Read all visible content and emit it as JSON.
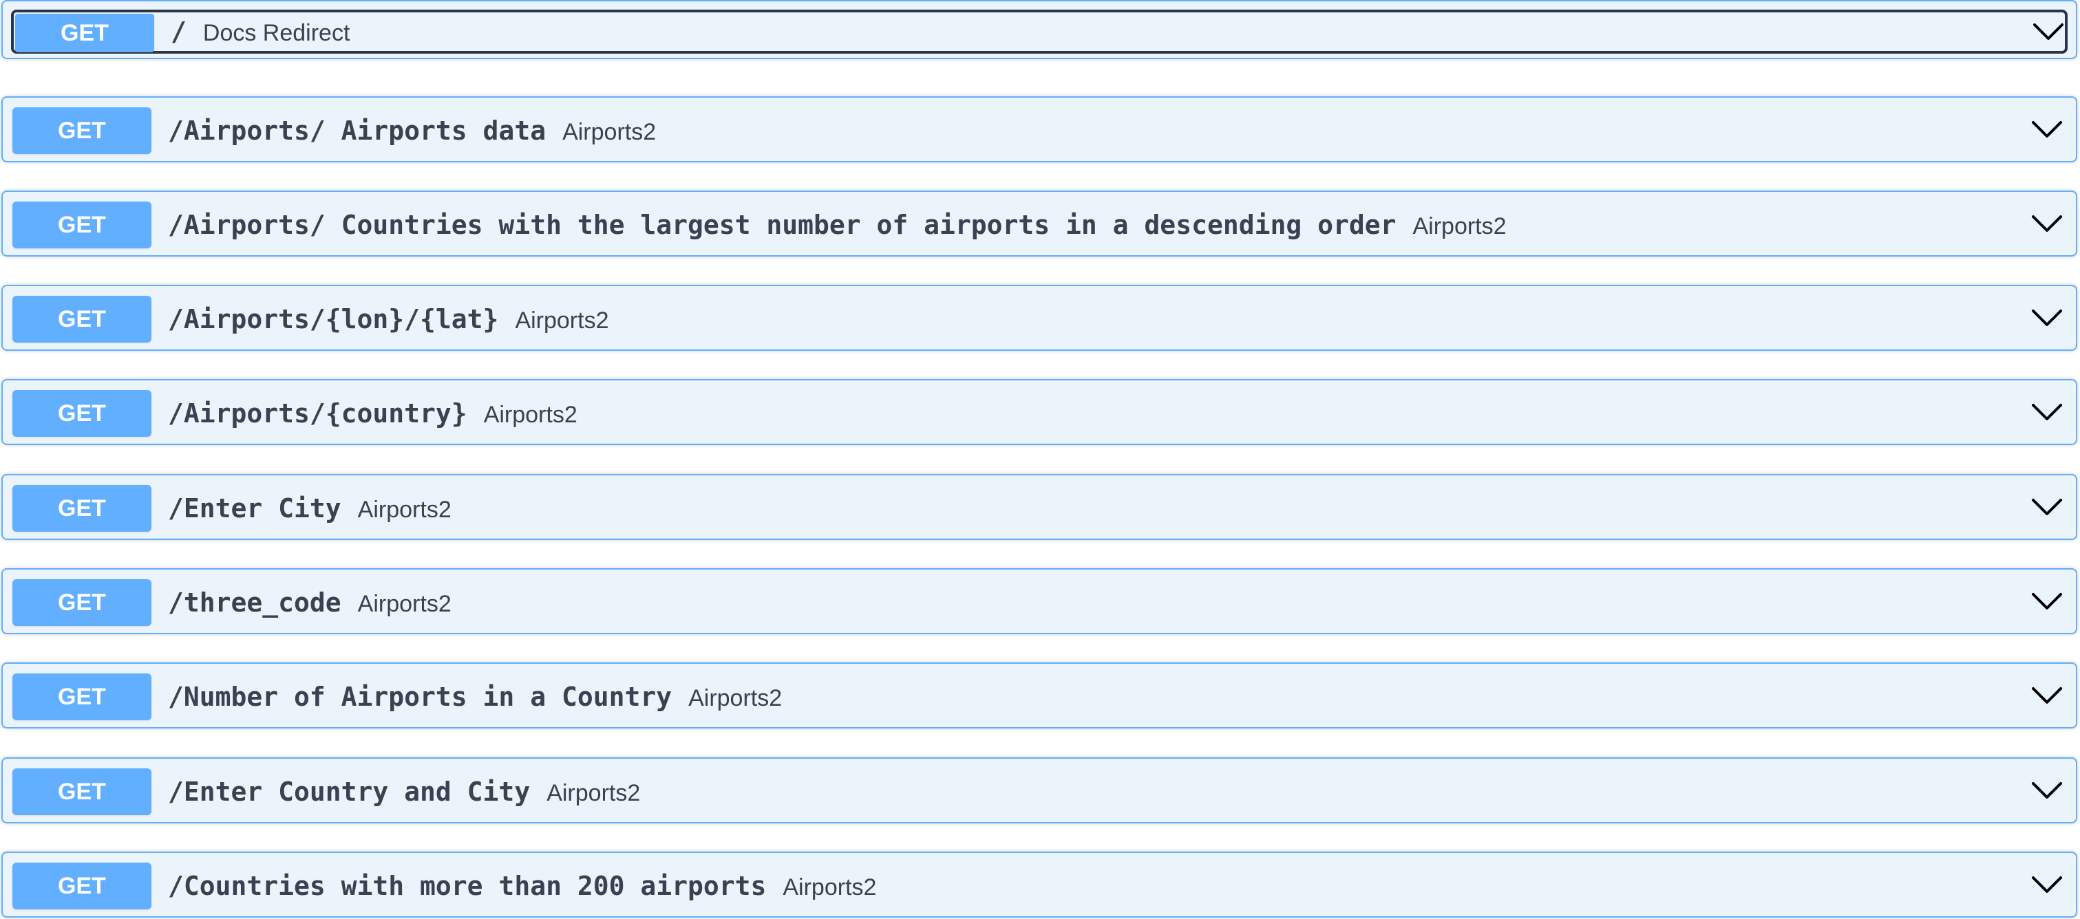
{
  "operations": [
    {
      "method": "GET",
      "path": "/",
      "summary": "Docs Redirect",
      "tag": ""
    },
    {
      "method": "GET",
      "path": "/Airports/ Airports data",
      "summary": "",
      "tag": "Airports2"
    },
    {
      "method": "GET",
      "path": "/Airports/ Countries with the largest number of airports in a descending order",
      "summary": "",
      "tag": "Airports2"
    },
    {
      "method": "GET",
      "path": "/Airports/{lon}/{lat}",
      "summary": "",
      "tag": "Airports2"
    },
    {
      "method": "GET",
      "path": "/Airports/{country}",
      "summary": "",
      "tag": "Airports2"
    },
    {
      "method": "GET",
      "path": "/Enter City",
      "summary": "",
      "tag": "Airports2"
    },
    {
      "method": "GET",
      "path": "/three_code",
      "summary": "",
      "tag": "Airports2"
    },
    {
      "method": "GET",
      "path": "/Number of Airports in a Country",
      "summary": "",
      "tag": "Airports2"
    },
    {
      "method": "GET",
      "path": "/Enter Country and City",
      "summary": "",
      "tag": "Airports2"
    },
    {
      "method": "GET",
      "path": "/Countries with more than 200 airports",
      "summary": "",
      "tag": "Airports2"
    }
  ],
  "colors": {
    "get_accent": "#61affe",
    "get_background": "#ebf3fb",
    "text": "#3b4151"
  },
  "icons": {
    "expand": "chevron-down-icon"
  }
}
